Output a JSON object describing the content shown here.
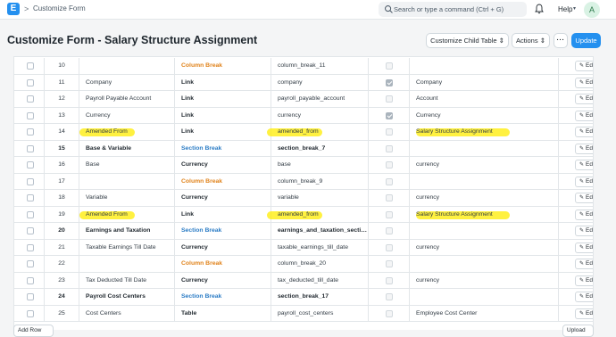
{
  "navbar": {
    "logo": "E",
    "breadcrumb_sep": ">",
    "breadcrumb": "Customize Form",
    "search_placeholder": "Search or type a command (Ctrl + G)",
    "help": "Help",
    "avatar_initial": "A"
  },
  "page": {
    "title": "Customize Form - Salary Structure Assignment",
    "customize_child_table": "Customize Child Table",
    "actions": "Actions",
    "more": "···",
    "update": "Update"
  },
  "table": {
    "edit_label": "Edit",
    "rows": [
      {
        "idx": "10",
        "label": "",
        "type": "Column Break",
        "type_style": "break",
        "fieldname": "column_break_11",
        "bold": false,
        "required": false,
        "options": "",
        "highlight": false
      },
      {
        "idx": "11",
        "label": "Company",
        "type": "Link",
        "type_style": "normal",
        "fieldname": "company",
        "bold": false,
        "required": true,
        "options": "Company",
        "highlight": false
      },
      {
        "idx": "12",
        "label": "Payroll Payable Account",
        "type": "Link",
        "type_style": "normal",
        "fieldname": "payroll_payable_account",
        "bold": false,
        "required": false,
        "options": "Account",
        "highlight": false
      },
      {
        "idx": "13",
        "label": "Currency",
        "type": "Link",
        "type_style": "normal",
        "fieldname": "currency",
        "bold": false,
        "required": true,
        "options": "Currency",
        "highlight": false
      },
      {
        "idx": "14",
        "label": "Amended From",
        "type": "Link",
        "type_style": "normal",
        "fieldname": "amended_from",
        "bold": false,
        "required": false,
        "options": "Salary Structure Assignment",
        "highlight": true
      },
      {
        "idx": "15",
        "label": "Base & Variable",
        "type": "Section Break",
        "type_style": "section",
        "fieldname": "section_break_7",
        "bold": true,
        "required": false,
        "options": "",
        "highlight": false
      },
      {
        "idx": "16",
        "label": "Base",
        "type": "Currency",
        "type_style": "normal",
        "fieldname": "base",
        "bold": false,
        "required": false,
        "options": "currency",
        "highlight": false
      },
      {
        "idx": "17",
        "label": "",
        "type": "Column Break",
        "type_style": "break",
        "fieldname": "column_break_9",
        "bold": false,
        "required": false,
        "options": "",
        "highlight": false
      },
      {
        "idx": "18",
        "label": "Variable",
        "type": "Currency",
        "type_style": "normal",
        "fieldname": "variable",
        "bold": false,
        "required": false,
        "options": "currency",
        "highlight": false
      },
      {
        "idx": "19",
        "label": "Amended From",
        "type": "Link",
        "type_style": "normal",
        "fieldname": "amended_from",
        "bold": false,
        "required": false,
        "options": "Salary Structure Assignment",
        "highlight": true
      },
      {
        "idx": "20",
        "label": "Earnings and Taxation",
        "type": "Section Break",
        "type_style": "section",
        "fieldname": "earnings_and_taxation_secti…",
        "bold": true,
        "required": false,
        "options": "",
        "highlight": false
      },
      {
        "idx": "21",
        "label": "Taxable Earnings Till Date",
        "type": "Currency",
        "type_style": "normal",
        "fieldname": "taxable_earnings_till_date",
        "bold": false,
        "required": false,
        "options": "currency",
        "highlight": false
      },
      {
        "idx": "22",
        "label": "",
        "type": "Column Break",
        "type_style": "break",
        "fieldname": "column_break_20",
        "bold": false,
        "required": false,
        "options": "",
        "highlight": false
      },
      {
        "idx": "23",
        "label": "Tax Deducted Till Date",
        "type": "Currency",
        "type_style": "normal",
        "fieldname": "tax_deducted_till_date",
        "bold": false,
        "required": false,
        "options": "currency",
        "highlight": false
      },
      {
        "idx": "24",
        "label": "Payroll Cost Centers",
        "type": "Section Break",
        "type_style": "section",
        "fieldname": "section_break_17",
        "bold": true,
        "required": false,
        "options": "",
        "highlight": false
      },
      {
        "idx": "25",
        "label": "Cost Centers",
        "type": "Table",
        "type_style": "normal",
        "fieldname": "payroll_cost_centers",
        "bold": false,
        "required": false,
        "options": "Employee Cost Center",
        "highlight": false
      }
    ]
  },
  "footer": {
    "add_row": "Add Row",
    "right_button": "Upload"
  },
  "colors": {
    "primary": "#2490ef",
    "column_break": "#e0821a",
    "section_break": "#2b7cc5",
    "highlight": "#ffec00"
  }
}
